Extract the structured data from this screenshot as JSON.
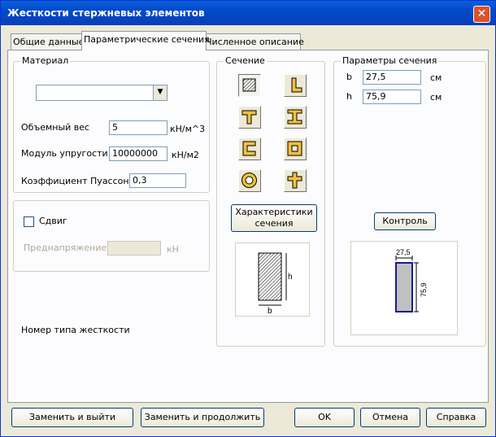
{
  "window": {
    "title": "Жесткости стержневых элементов",
    "close_label": "✕"
  },
  "tabs": [
    {
      "label": "Общие данные"
    },
    {
      "label": "Параметрические сечения"
    },
    {
      "label": "Численное описание"
    }
  ],
  "material": {
    "group_label": "Материал",
    "combo_value": "",
    "weight_label": "Объемный вес",
    "weight_value": "5",
    "weight_unit": "кН/м^3",
    "modulus_label": "Модуль упругости",
    "modulus_value": "10000000",
    "modulus_unit": "кН/м2",
    "poisson_label": "Коэффициент Пуассона",
    "poisson_value": "0,3"
  },
  "shear": {
    "checkbox_label": "Сдвиг",
    "prestress_label": "Преднапряжение",
    "prestress_value": "",
    "prestress_unit": "кН"
  },
  "stiffness_type_label": "Номер типа жесткости",
  "section": {
    "group_label": "Сечение",
    "shapes": [
      "rectangle",
      "angle",
      "tee",
      "i-beam",
      "channel",
      "box",
      "ring",
      "cross"
    ],
    "characteristics_label_1": "Характеристики",
    "characteristics_label_2": "сечения",
    "preview_b": "b",
    "preview_h": "h"
  },
  "params": {
    "group_label": "Параметры сечения",
    "b_label": "b",
    "b_value": "27,5",
    "b_unit": "см",
    "h_label": "h",
    "h_value": "75,9",
    "h_unit": "см",
    "control_label": "Контроль",
    "dim_b": "27,5",
    "dim_h": "75,9"
  },
  "buttons": {
    "replace_exit": "Заменить и выйти",
    "replace_continue": "Заменить и продолжить",
    "ok": "OK",
    "cancel": "Отмена",
    "help": "Справка"
  },
  "colors": {
    "title_bar": "#0a5fd8",
    "accent_blue": "#0831d9",
    "section_fill": "#c0c0c0"
  }
}
